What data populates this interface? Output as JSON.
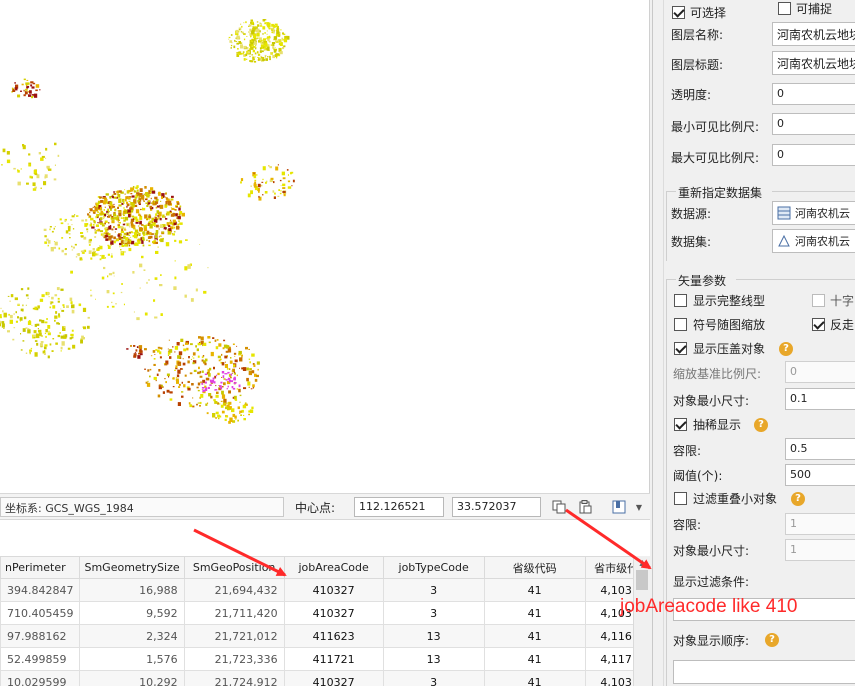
{
  "statusbar": {
    "coord_system": "坐标系: GCS_WGS_1984",
    "center_label": "中心点:",
    "center_x": "112.126521",
    "center_y": "33.572037"
  },
  "table": {
    "columns": [
      "nPerimeter",
      "SmGeometrySize",
      "SmGeoPosition",
      "jobAreaCode",
      "jobTypeCode",
      "省级代码",
      "省市级代"
    ],
    "rows": [
      [
        "394.842847",
        "16,988",
        "21,694,432",
        "410327",
        "3",
        "41",
        "4,103"
      ],
      [
        "710.405459",
        "9,592",
        "21,711,420",
        "410327",
        "3",
        "41",
        "4,103"
      ],
      [
        "97.988162",
        "2,324",
        "21,721,012",
        "411623",
        "13",
        "41",
        "4,116"
      ],
      [
        "52.499859",
        "1,576",
        "21,723,336",
        "411721",
        "13",
        "41",
        "4,117"
      ],
      [
        "10.029599",
        "10,292",
        "21,724,912",
        "410327",
        "3",
        "41",
        "4,103"
      ]
    ]
  },
  "panel": {
    "selectable_label": "可选择",
    "snappable_label": "可捕捉",
    "layer_name_label": "图层名称:",
    "layer_name_value": "河南农机云地块",
    "layer_title_label": "图层标题:",
    "layer_title_value": "河南农机云地块",
    "opacity_label": "透明度:",
    "opacity_value": "0",
    "min_scale_label": "最小可见比例尺:",
    "min_scale_value": "0",
    "max_scale_label": "最大可见比例尺:",
    "max_scale_value": "0",
    "reassign_title": "重新指定数据集",
    "datasource_label": "数据源:",
    "datasource_value": "河南农机云",
    "dataset_label": "数据集:",
    "dataset_value": "河南农机云",
    "vector_title": "矢量参数",
    "show_full_line_label": "显示完整线型",
    "crosshair_label": "十字",
    "symbol_scale_label": "符号随图缩放",
    "antialias_label": "反走",
    "show_overlap_label": "显示压盖对象",
    "scale_base_label": "缩放基准比例尺:",
    "scale_base_value": "0",
    "min_obj_size_label": "对象最小尺寸:",
    "min_obj_size_value": "0.1",
    "thin_display_label": "抽稀显示",
    "tolerance_label": "容限:",
    "tolerance_value": "0.5",
    "threshold_label": "阈值(个):",
    "threshold_value": "500",
    "filter_overlap_label": "过滤重叠小对象",
    "tolerance2_label": "容限:",
    "tolerance2_value": "1",
    "min_obj_size2_label": "对象最小尺寸:",
    "min_obj_size2_value": "1",
    "filter_cond_label": "显示过滤条件:",
    "filter_cond_value": "jobAreacode like 410",
    "display_order_label": "对象显示顺序:",
    "help_glyph": "?"
  },
  "colors": {
    "annotation_red": "#ff2a2a",
    "help_orange": "#e8a72a"
  }
}
